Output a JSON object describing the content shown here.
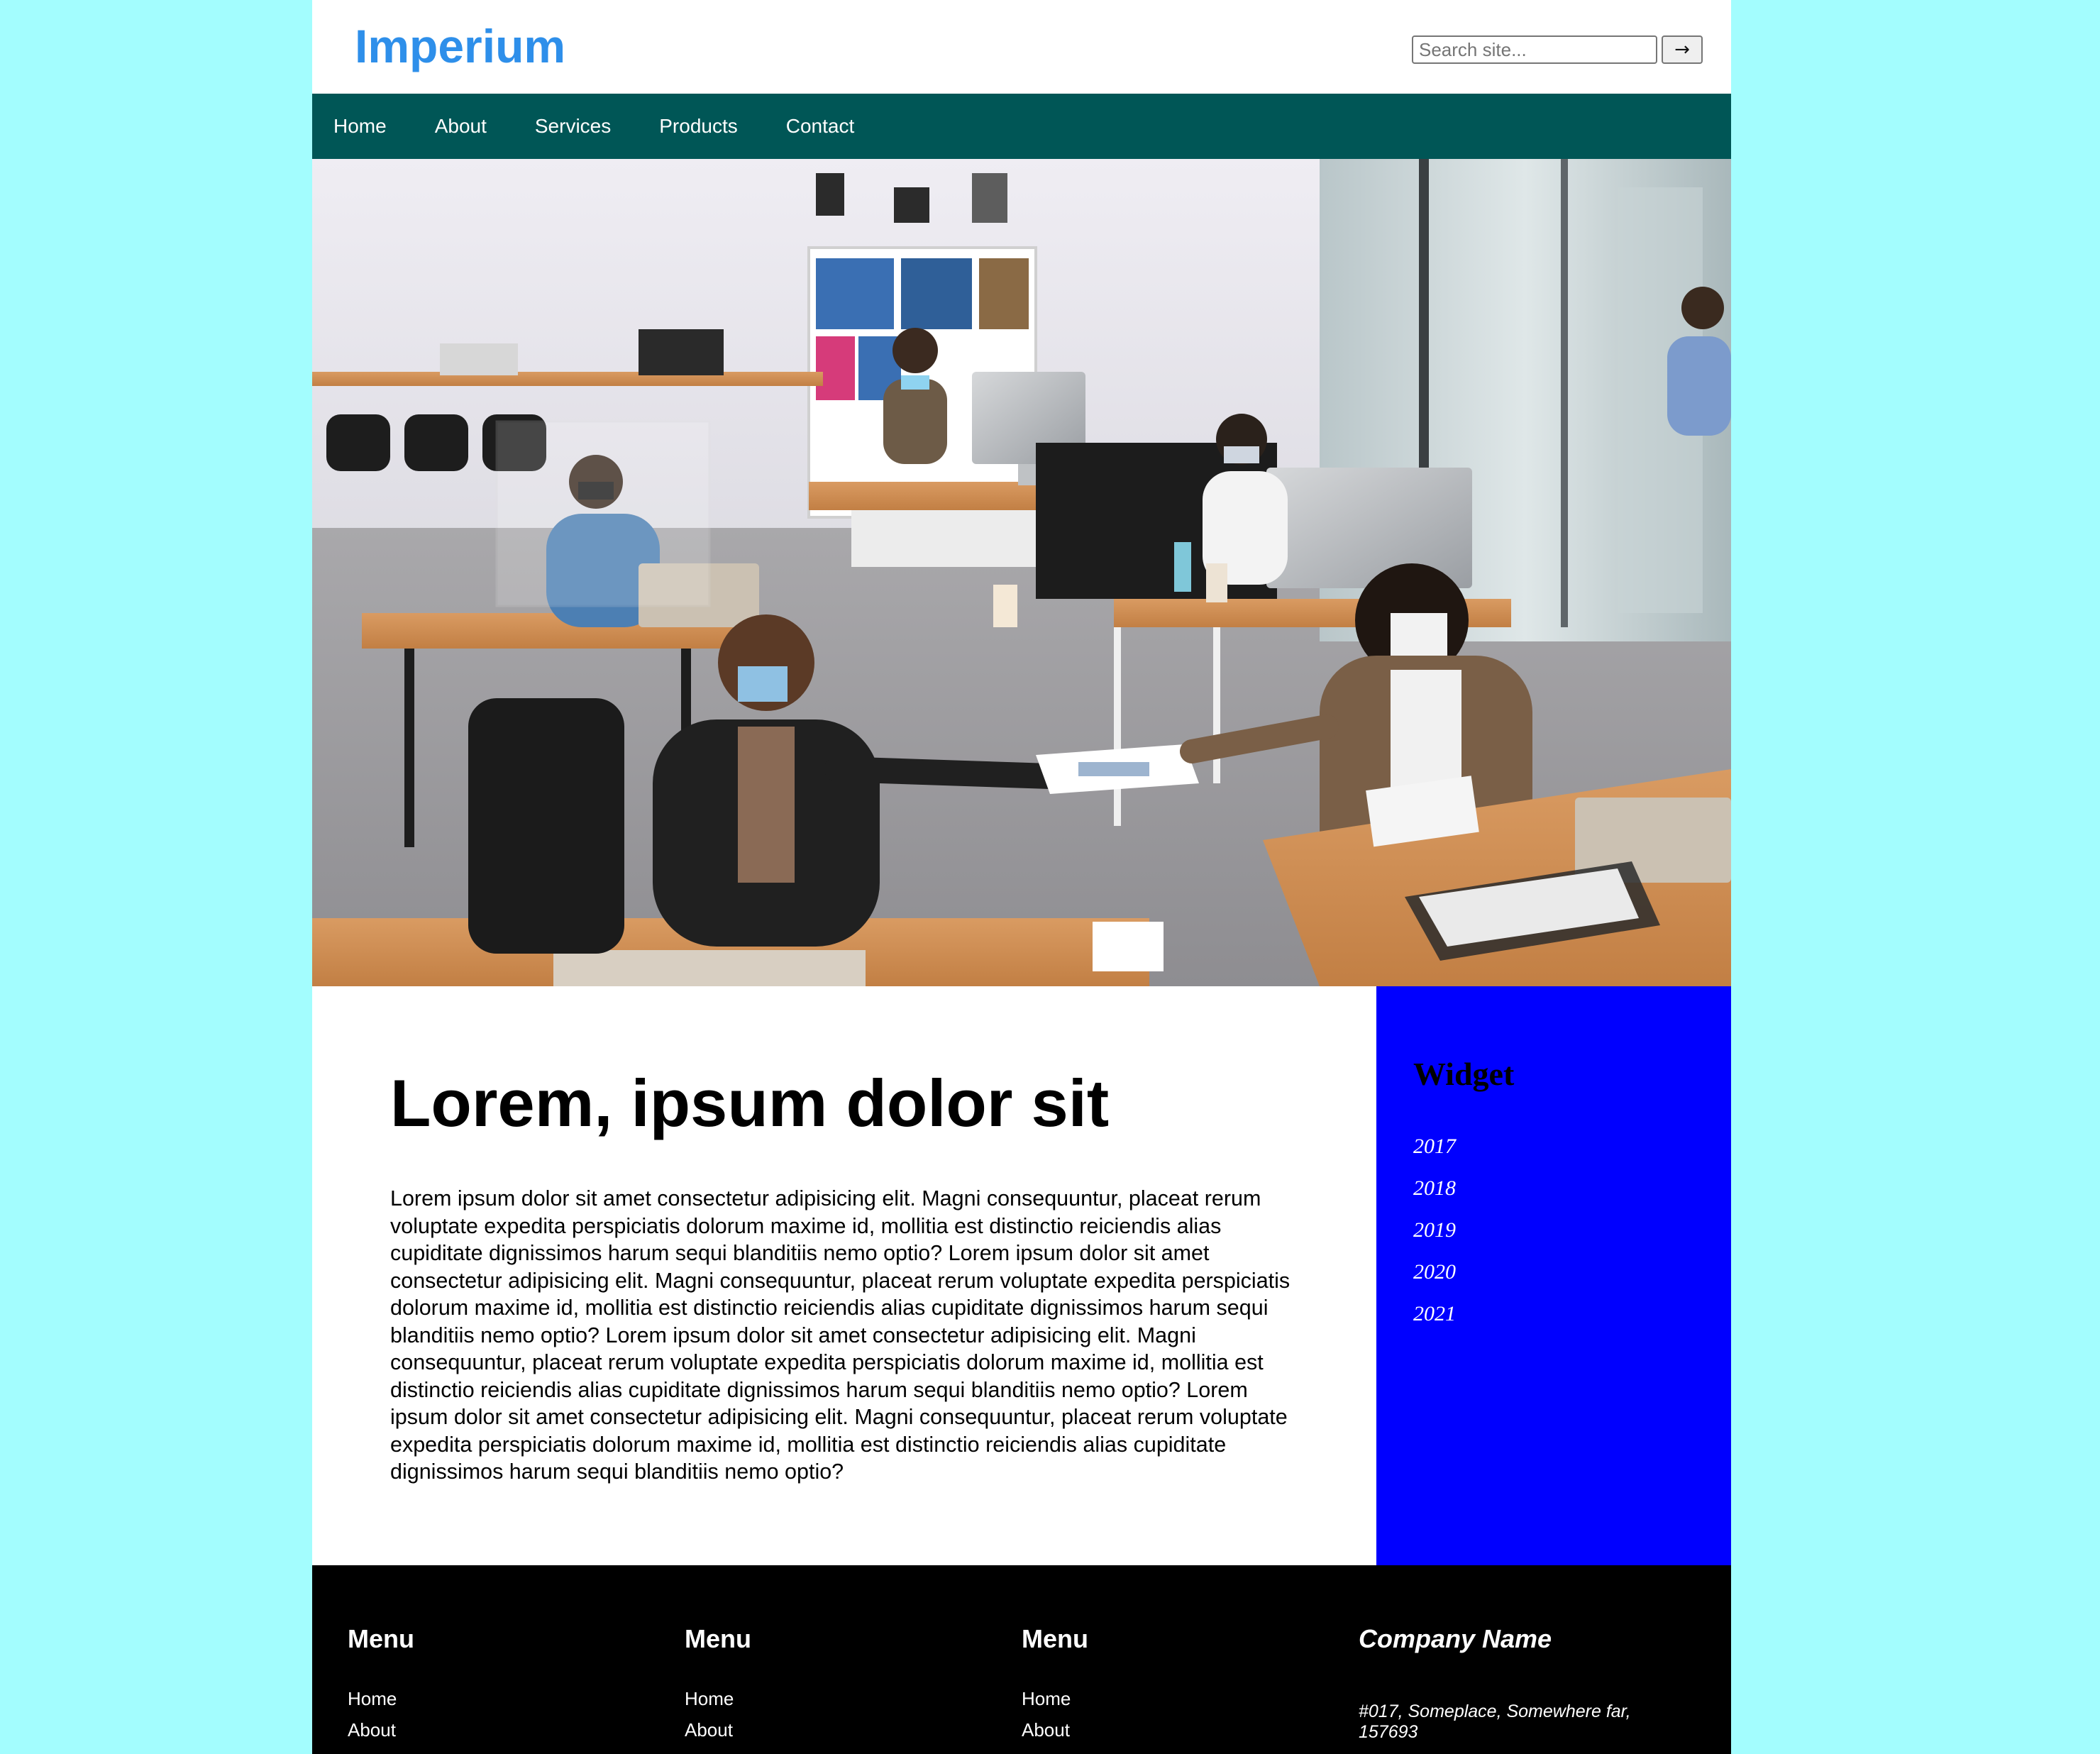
{
  "header": {
    "logo": "Imperium",
    "search_placeholder": "Search site...",
    "search_button": "→"
  },
  "nav": {
    "items": [
      {
        "label": "Home"
      },
      {
        "label": "About"
      },
      {
        "label": "Services"
      },
      {
        "label": "Products"
      },
      {
        "label": "Contact"
      }
    ]
  },
  "hero": {
    "image_icon": "office-photo"
  },
  "main": {
    "title": "Lorem, ipsum dolor sit",
    "body": "Lorem ipsum dolor sit amet consectetur adipisicing elit. Magni consequuntur, placeat rerum voluptate expedita perspiciatis dolorum maxime id, mollitia est distinctio reiciendis alias cupiditate dignissimos harum sequi blanditiis nemo optio? Lorem ipsum dolor sit amet consectetur adipisicing elit. Magni consequuntur, placeat rerum voluptate expedita perspiciatis dolorum maxime id, mollitia est distinctio reiciendis alias cupiditate dignissimos harum sequi blanditiis nemo optio? Lorem ipsum dolor sit amet consectetur adipisicing elit. Magni consequuntur, placeat rerum voluptate expedita perspiciatis dolorum maxime id, mollitia est distinctio reiciendis alias cupiditate dignissimos harum sequi blanditiis nemo optio? Lorem ipsum dolor sit amet consectetur adipisicing elit. Magni consequuntur, placeat rerum voluptate expedita perspiciatis dolorum maxime id, mollitia est distinctio reiciendis alias cupiditate dignissimos harum sequi blanditiis nemo optio?"
  },
  "widget": {
    "title": "Widget",
    "items": [
      {
        "label": "2017"
      },
      {
        "label": "2018"
      },
      {
        "label": "2019"
      },
      {
        "label": "2020"
      },
      {
        "label": "2021"
      }
    ]
  },
  "footer": {
    "columns": [
      {
        "heading": "Menu",
        "links": [
          {
            "label": "Home"
          },
          {
            "label": "About"
          }
        ]
      },
      {
        "heading": "Menu",
        "links": [
          {
            "label": "Home"
          },
          {
            "label": "About"
          }
        ]
      },
      {
        "heading": "Menu",
        "links": [
          {
            "label": "Home"
          },
          {
            "label": "About"
          }
        ]
      }
    ],
    "company": {
      "name": "Company Name",
      "address": "#017, Someplace, Somewhere far, 157693"
    }
  },
  "colors": {
    "page_background": "#a3fdfe",
    "logo": "#2e8fea",
    "nav_background": "#005656",
    "widget_background": "#0000ff",
    "footer_background": "#000000"
  }
}
